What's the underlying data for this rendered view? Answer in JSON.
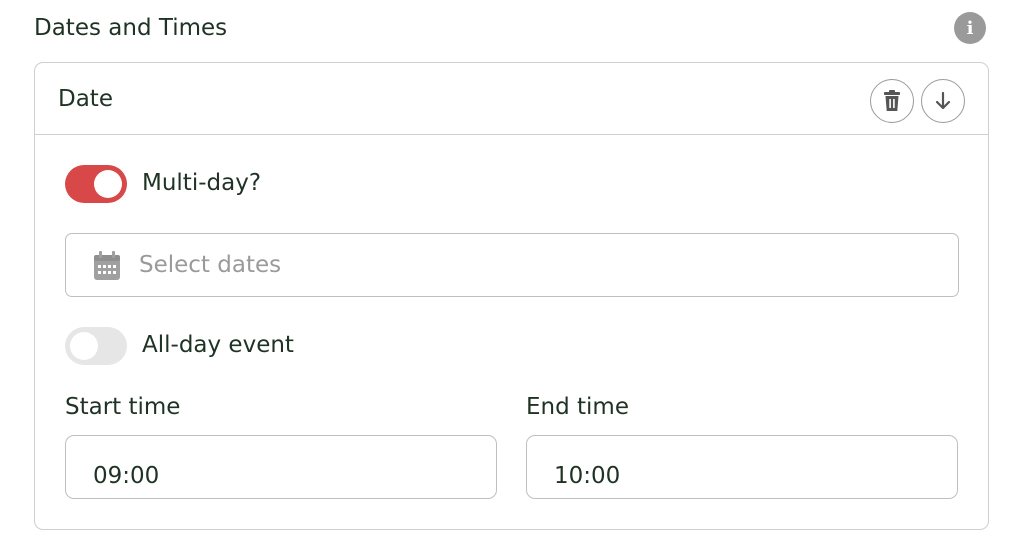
{
  "section": {
    "title": "Dates and Times",
    "info_icon": "info-icon"
  },
  "card": {
    "title": "Date",
    "delete_icon": "trash-icon",
    "move_down_icon": "arrow-down-icon"
  },
  "multi_day": {
    "label": "Multi-day?",
    "checked": true,
    "color": "#d84848"
  },
  "date_picker": {
    "placeholder": "Select dates",
    "icon": "calendar-icon",
    "value": ""
  },
  "all_day": {
    "label": "All-day event",
    "checked": false
  },
  "start_time": {
    "label": "Start time",
    "value": "09:00"
  },
  "end_time": {
    "label": "End time",
    "value": "10:00"
  }
}
